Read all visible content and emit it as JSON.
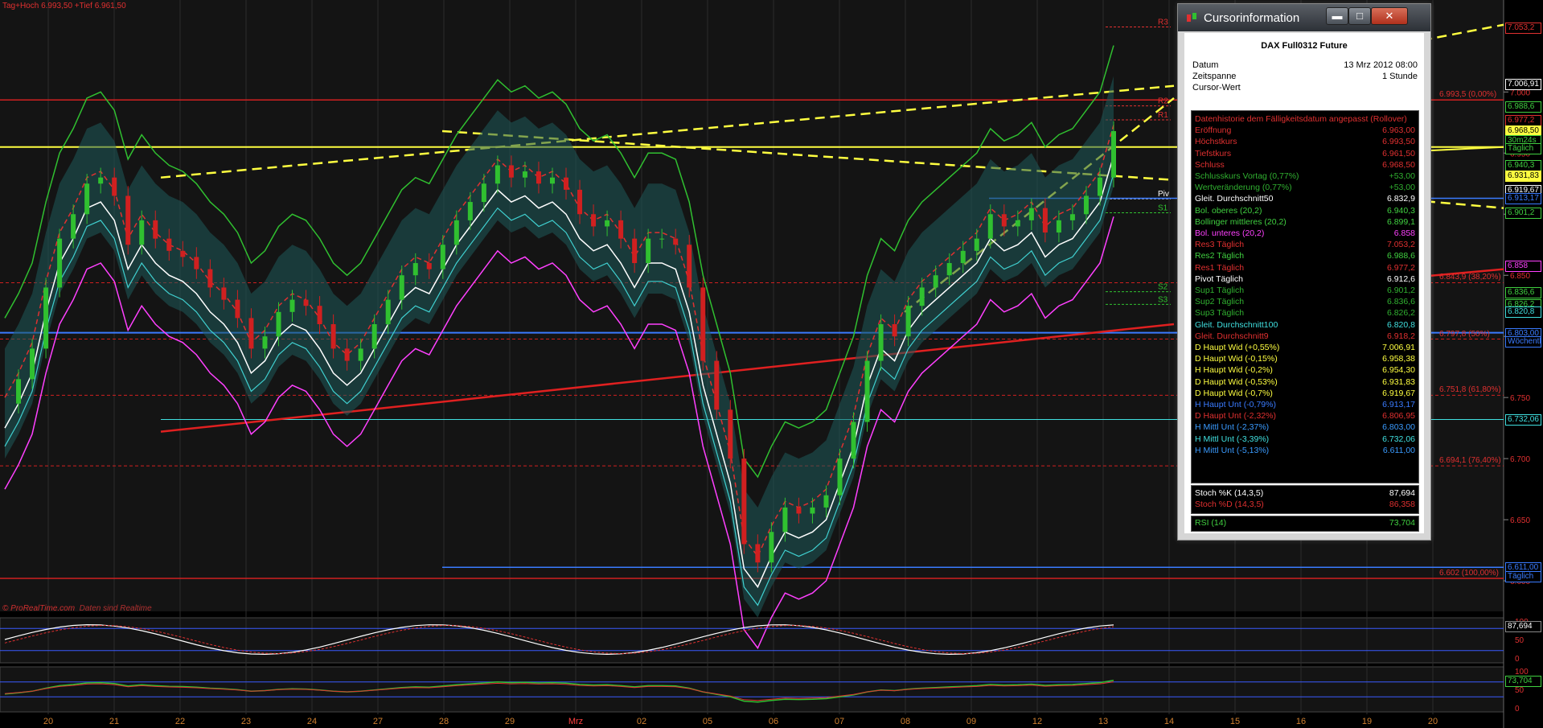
{
  "header": {
    "text": "Tag+Hoch 6.993,50 +Tief 6.961,50"
  },
  "credit": {
    "site": "© ProRealTime.com",
    "note": "Daten sind Realtime"
  },
  "chart_data": {
    "type": "candlestick",
    "instrument": "DAX Full0312 Future",
    "timeframe": "1 Stunde",
    "x_labels": [
      "20",
      "21",
      "22",
      "23",
      "24",
      "27",
      "28",
      "29",
      "Mrz",
      "02",
      "05",
      "06",
      "07",
      "08",
      "09",
      "12",
      "13",
      "14",
      "15",
      "16",
      "19",
      "20"
    ],
    "ylim": [
      6575,
      7070
    ],
    "price_ticks": [
      "7.000",
      "6.950",
      "6.900",
      "6.850",
      "6.800",
      "6.750",
      "6.700",
      "6.650",
      "6.600"
    ],
    "close_path": [
      [
        0,
        6745
      ],
      [
        2,
        6765
      ],
      [
        4,
        6790
      ],
      [
        6,
        6840
      ],
      [
        8,
        6880
      ],
      [
        10,
        6900
      ],
      [
        12,
        6925
      ],
      [
        14,
        6930
      ],
      [
        16,
        6915
      ],
      [
        18,
        6875
      ],
      [
        20,
        6895
      ],
      [
        22,
        6880
      ],
      [
        24,
        6870
      ],
      [
        26,
        6865
      ],
      [
        28,
        6855
      ],
      [
        30,
        6840
      ],
      [
        32,
        6830
      ],
      [
        34,
        6815
      ],
      [
        36,
        6790
      ],
      [
        38,
        6800
      ],
      [
        40,
        6820
      ],
      [
        42,
        6830
      ],
      [
        44,
        6825
      ],
      [
        46,
        6810
      ],
      [
        48,
        6790
      ],
      [
        50,
        6780
      ],
      [
        52,
        6790
      ],
      [
        54,
        6810
      ],
      [
        56,
        6830
      ],
      [
        58,
        6850
      ],
      [
        60,
        6860
      ],
      [
        62,
        6855
      ],
      [
        64,
        6875
      ],
      [
        66,
        6895
      ],
      [
        68,
        6910
      ],
      [
        70,
        6925
      ],
      [
        72,
        6940
      ],
      [
        74,
        6930
      ],
      [
        76,
        6935
      ],
      [
        78,
        6925
      ],
      [
        80,
        6930
      ],
      [
        82,
        6920
      ],
      [
        84,
        6900
      ],
      [
        86,
        6890
      ],
      [
        88,
        6895
      ],
      [
        90,
        6880
      ],
      [
        92,
        6860
      ],
      [
        94,
        6880
      ],
      [
        96,
        6880
      ],
      [
        98,
        6875
      ],
      [
        100,
        6840
      ],
      [
        102,
        6780
      ],
      [
        104,
        6740
      ],
      [
        106,
        6700
      ],
      [
        108,
        6630
      ],
      [
        110,
        6615
      ],
      [
        112,
        6640
      ],
      [
        114,
        6660
      ],
      [
        116,
        6655
      ],
      [
        118,
        6660
      ],
      [
        120,
        6670
      ],
      [
        122,
        6700
      ],
      [
        124,
        6730
      ],
      [
        126,
        6780
      ],
      [
        128,
        6810
      ],
      [
        130,
        6800
      ],
      [
        132,
        6825
      ],
      [
        134,
        6840
      ],
      [
        136,
        6850
      ],
      [
        138,
        6860
      ],
      [
        140,
        6870
      ],
      [
        142,
        6880
      ],
      [
        144,
        6900
      ],
      [
        146,
        6890
      ],
      [
        148,
        6895
      ],
      [
        150,
        6905
      ],
      [
        152,
        6885
      ],
      [
        154,
        6895
      ],
      [
        156,
        6900
      ],
      [
        158,
        6915
      ],
      [
        160,
        6930
      ],
      [
        162,
        6968
      ]
    ],
    "total_bars": 162,
    "resistance_lines": [
      {
        "name": "R3",
        "value": 7053.2,
        "label": ""
      },
      {
        "name": "R2",
        "value": 6988.6,
        "label": ""
      },
      {
        "name": "R1",
        "value": 6977.2,
        "label": ""
      },
      {
        "name": "Piv",
        "value": 6912.6,
        "label": ""
      },
      {
        "name": "S1",
        "value": 6901.2,
        "label": ""
      },
      {
        "name": "S2",
        "value": 6836.6,
        "label": ""
      },
      {
        "name": "S3",
        "value": 6826.2,
        "label": ""
      }
    ],
    "fib_lines": [
      {
        "value": 6993.5,
        "label": "6.993,5 (0,00%)"
      },
      {
        "value": 6843.9,
        "label": "6.843,9 (38,20%)"
      },
      {
        "value": 6797.8,
        "label": "6.797,8 (50%)"
      },
      {
        "value": 6751.8,
        "label": "6.751,8 (61,80%)"
      },
      {
        "value": 6694.1,
        "label": "6.694,1 (76,40%)"
      },
      {
        "value": 6602,
        "label": "6.602 (100,00%)"
      }
    ],
    "price_tags": [
      {
        "text": "7.053,2",
        "value": 7053.2,
        "color": "#e03030"
      },
      {
        "text": "7.006,91",
        "value": 7006.91,
        "color": "#ffffff"
      },
      {
        "text": "6.988,6",
        "value": 6988.6,
        "color": "#40d040"
      },
      {
        "text": "6.977,2",
        "value": 6977.2,
        "color": "#e03030"
      },
      {
        "text": "6.968,50",
        "value": 6968.5,
        "color": "#ffff40"
      },
      {
        "text": "30m24s",
        "value": 6961,
        "color": "#40d040"
      },
      {
        "text": "Täglich",
        "value": 6954,
        "color": "#40d040"
      },
      {
        "text": "6.940,3",
        "value": 6940.3,
        "color": "#40d040"
      },
      {
        "text": "6.931,83",
        "value": 6931.83,
        "color": "#ffff40"
      },
      {
        "text": "6.919,67",
        "value": 6919.67,
        "color": "#ffffff"
      },
      {
        "text": "6.913,17",
        "value": 6913.17,
        "color": "#3a7bff"
      },
      {
        "text": "6.901,2",
        "value": 6901.2,
        "color": "#40d040"
      },
      {
        "text": "6.858",
        "value": 6858,
        "color": "#ff40ff"
      },
      {
        "text": "6.836,6",
        "value": 6836.6,
        "color": "#40d040"
      },
      {
        "text": "6.826,2",
        "value": 6826.2,
        "color": "#40d040"
      },
      {
        "text": "6.820,8",
        "value": 6820.8,
        "color": "#40e0e0"
      },
      {
        "text": "6.803,00",
        "value": 6803,
        "color": "#3a7bff"
      },
      {
        "text": "Wöchentl",
        "value": 6796,
        "color": "#3a7bff"
      },
      {
        "text": "6.732,06",
        "value": 6732.06,
        "color": "#40e0e0"
      },
      {
        "text": "6.611,00",
        "value": 6611,
        "color": "#3a7bff"
      },
      {
        "text": "Täglich",
        "value": 6604,
        "color": "#3a7bff"
      }
    ],
    "stochastic": {
      "k": 87.694,
      "d": 86.358,
      "levels": [
        100,
        50,
        0
      ]
    },
    "rsi": {
      "value": 73.704,
      "levels": [
        100,
        50,
        0
      ]
    },
    "indicator_tags": {
      "stoch": "87,694",
      "rsi": "73,704"
    }
  },
  "cursor_window": {
    "title": "Cursorinformation",
    "instrument": "DAX Full0312 Future",
    "meta": [
      {
        "k": "Datum",
        "v": "13 Mrz 2012 08:00"
      },
      {
        "k": "Zeitspanne",
        "v": "1 Stunde"
      },
      {
        "k": "Cursor-Wert",
        "v": ""
      }
    ],
    "rows": [
      {
        "k": "Datenhistorie dem Fälligkeitsdatum angepasst (Rollover)",
        "v": "",
        "c": "#e03030"
      },
      {
        "k": "Eröffnung",
        "v": "6.963,00",
        "c": "#e03030"
      },
      {
        "k": "Höchstkurs",
        "v": "6.993,50",
        "c": "#e03030"
      },
      {
        "k": "Tiefstkurs",
        "v": "6.961,50",
        "c": "#e03030"
      },
      {
        "k": "Schluss",
        "v": "6.968,50",
        "c": "#e03030"
      },
      {
        "k": "Schlusskurs Vortag (0,77%)",
        "v": "+53,00",
        "c": "#30b030"
      },
      {
        "k": "Wertveränderung (0,77%)",
        "v": "+53,00",
        "c": "#30b030"
      },
      {
        "k": "Gleit. Durchschnitt50",
        "v": "6.832,9",
        "c": "#ffffff"
      },
      {
        "k": "Bol. oberes (20,2)",
        "v": "6.940,3",
        "c": "#40d040"
      },
      {
        "k": "Bollinger mittleres (20,2)",
        "v": "6.899,1",
        "c": "#40d040"
      },
      {
        "k": "Bol. unteres (20,2)",
        "v": "6.858",
        "c": "#ff40ff"
      },
      {
        "k": "Res3 Täglich",
        "v": "7.053,2",
        "c": "#e03030"
      },
      {
        "k": "Res2 Täglich",
        "v": "6.988,6",
        "c": "#40d040"
      },
      {
        "k": "Res1 Täglich",
        "v": "6.977,2",
        "c": "#e03030"
      },
      {
        "k": "Pivot Täglich",
        "v": "6.912,6",
        "c": "#ffffff"
      },
      {
        "k": "Sup1 Täglich",
        "v": "6.901,2",
        "c": "#30b030"
      },
      {
        "k": "Sup2 Täglich",
        "v": "6.836,6",
        "c": "#30b030"
      },
      {
        "k": "Sup3 Täglich",
        "v": "6.826,2",
        "c": "#30b030"
      },
      {
        "k": "Gleit. Durchschnitt100",
        "v": "6.820,8",
        "c": "#40e0e0"
      },
      {
        "k": "Gleit. Durchschnitt9",
        "v": "6.918,2",
        "c": "#e03030"
      },
      {
        "k": "D Haupt Wid (+0,55%)",
        "v": "7.006,91",
        "c": "#ffff40"
      },
      {
        "k": "D Haupt Wid (-0,15%)",
        "v": "6.958,38",
        "c": "#ffff40"
      },
      {
        "k": "H Haupt Wid (-0,2%)",
        "v": "6.954,30",
        "c": "#ffff40"
      },
      {
        "k": "D Haupt Wid (-0,53%)",
        "v": "6.931,83",
        "c": "#ffff40"
      },
      {
        "k": "D Haupt Wid (-0,7%)",
        "v": "6.919,67",
        "c": "#ffff40"
      },
      {
        "k": "H Haupt Unt (-0,79%)",
        "v": "6.913,17",
        "c": "#3a7bff"
      },
      {
        "k": "D Haupt Unt (-2,32%)",
        "v": "6.806,95",
        "c": "#e03030"
      },
      {
        "k": "H Mittl Unt (-2,37%)",
        "v": "6.803,00",
        "c": "#3a9bff"
      },
      {
        "k": "H Mittl Unt (-3,39%)",
        "v": "6.732,06",
        "c": "#40e0e0"
      },
      {
        "k": "H Mittl Unt (-5,13%)",
        "v": "6.611,00",
        "c": "#3a9bff"
      }
    ],
    "stoch_rows": [
      {
        "k": "Stoch %K (14,3,5)",
        "v": "87,694",
        "c": "#ffffff"
      },
      {
        "k": "Stoch %D (14,3,5)",
        "v": "86,358",
        "c": "#e03030"
      }
    ],
    "rsi_row": {
      "k": "RSI (14)",
      "v": "73,704",
      "c": "#40d040"
    }
  },
  "window_buttons": {
    "minimize": "▬",
    "maximize": "□",
    "close": "✕"
  }
}
